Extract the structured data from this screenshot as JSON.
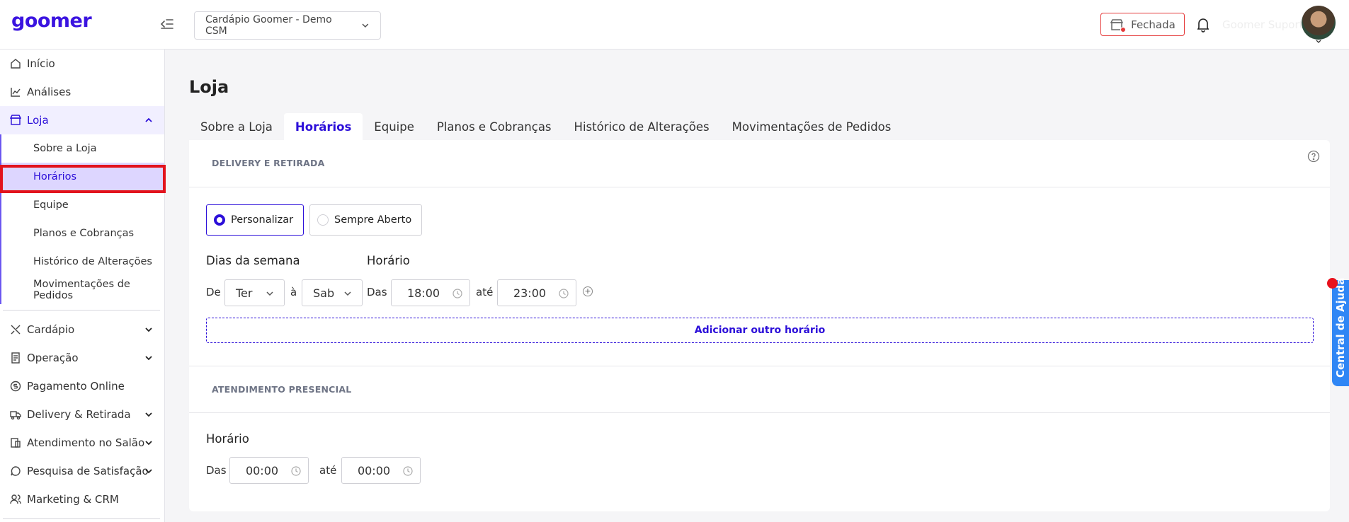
{
  "app": {
    "logo": "goomer"
  },
  "header": {
    "store_selector": "Cardápio Goomer - Demo CSM",
    "status_label": "Fechada",
    "user_name": "Goomer Suporte"
  },
  "sidebar": {
    "items": [
      {
        "label": "Início",
        "icon": "home-icon"
      },
      {
        "label": "Análises",
        "icon": "chart-icon"
      },
      {
        "label": "Loja",
        "icon": "store-icon"
      },
      {
        "label": "Cardápio",
        "icon": "utensils-icon"
      },
      {
        "label": "Operação",
        "icon": "receipt-icon"
      },
      {
        "label": "Pagamento Online",
        "icon": "dollar-icon"
      },
      {
        "label": "Delivery & Retirada",
        "icon": "delivery-icon"
      },
      {
        "label": "Atendimento no Salão",
        "icon": "table-icon"
      },
      {
        "label": "Pesquisa de Satisfação",
        "icon": "chat-icon"
      },
      {
        "label": "Marketing & CRM",
        "icon": "users-icon"
      }
    ],
    "loja_subitems": [
      {
        "label": "Sobre a Loja"
      },
      {
        "label": "Horários"
      },
      {
        "label": "Equipe"
      },
      {
        "label": "Planos e Cobranças"
      },
      {
        "label": "Histórico de Alterações"
      },
      {
        "label": "Movimentações de Pedidos"
      }
    ]
  },
  "main": {
    "title": "Loja",
    "tabs": [
      {
        "label": "Sobre a Loja"
      },
      {
        "label": "Horários"
      },
      {
        "label": "Equipe"
      },
      {
        "label": "Planos e Cobranças"
      },
      {
        "label": "Histórico de Alterações"
      },
      {
        "label": "Movimentações de Pedidos"
      }
    ],
    "delivery": {
      "section_title": "DELIVERY E RETIRADA",
      "mode_options": [
        "Personalizar",
        "Sempre Aberto"
      ],
      "selected_mode": "Personalizar",
      "days_label": "Dias da semana",
      "hours_label": "Horário",
      "from_label": "De",
      "to_day_label": "à",
      "day_from": "Ter",
      "day_to": "Sab",
      "time_from_label": "Das",
      "time_to_label": "até",
      "time_from": "18:00",
      "time_to": "23:00",
      "add_label": "Adicionar outro horário"
    },
    "presencial": {
      "section_title": "ATENDIMENTO PRESENCIAL",
      "hours_label": "Horário",
      "time_from_label": "Das",
      "time_to_label": "até",
      "time_from": "00:00",
      "time_to": "00:00"
    }
  },
  "help_widget": {
    "label": "Central de Ajuda"
  },
  "colors": {
    "brand": "#3b14e0",
    "accent": "#2c0fd9",
    "closed": "#e53b3b",
    "help": "#2f86f5"
  }
}
